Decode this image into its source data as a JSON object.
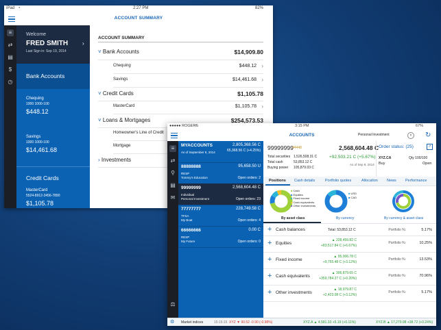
{
  "back": {
    "status": {
      "carrier": "iPad",
      "wifi": "◔",
      "time": "2:27 PM",
      "battery": "82%"
    },
    "nav_title": "ACCOUNT SUMMARY",
    "welcome": {
      "greeting": "Welcome",
      "name": "FRED SMITH",
      "last_signin": "Last Sign in: Sep 19, 2014"
    },
    "menu": {
      "bank_accounts": "Bank Accounts",
      "chequing_label": "Chequing",
      "chequing_num": "1000 1000-100",
      "chequing_bal": "$448.12",
      "savings_label": "Savings",
      "savings_num": "1000 1000-100",
      "savings_bal": "$14,461.68",
      "credit_cards": "Credit Cards",
      "mastercard_label": "MasterCard",
      "mastercard_num": "5524-8912-3456-7890",
      "mastercard_bal": "$1,105.78"
    },
    "summary": {
      "heading": "ACCOUNT SUMMARY",
      "bank_label": "Bank Accounts",
      "bank_total": "$14,909.80",
      "chequing": "Chequing",
      "chequing_amt": "$448.12",
      "savings": "Savings",
      "savings_amt": "$14,461.68",
      "cc_label": "Credit Cards",
      "cc_total": "$1,105.78",
      "mastercard": "MasterCard",
      "mastercard_amt": "$1,105.78",
      "loans_label": "Loans & Mortgages",
      "loans_total": "$254,573.53",
      "heloc": "Homeowner's Line of Credit",
      "mortgage": "Mortgage",
      "investments": "Investments"
    }
  },
  "front": {
    "status": {
      "carrier": "●●●●● ROGERS",
      "wifi": "◔",
      "time": "3:15 PM",
      "battery": "67%"
    },
    "nav_title": "ACCOUNTS",
    "investment_select": "Personal Investment",
    "accounts": [
      {
        "name": "MYACCOUNTS",
        "value": "2,805,368.56 C",
        "sub1": "As of September 9, 2014",
        "sub2": "",
        "extra": "65,368.56 C (+4.25%)"
      },
      {
        "name": "88888888",
        "value": "95,658.50 U",
        "sub1": "RESP",
        "sub2": "Tommy's Education",
        "extra": "Open orders: 2"
      },
      {
        "name": "99999999",
        "value": "2,568,604.48 C",
        "sub1": "Individual",
        "sub2": "Personal Investment",
        "extra": "Open orders: 23"
      },
      {
        "name": "77777777",
        "value": "228,749.58 C",
        "sub1": "TFSA",
        "sub2": "My Boat",
        "extra": "Open orders: 4"
      },
      {
        "name": "66666666",
        "value": "0.00 C",
        "sub1": "RESP",
        "sub2": "My Future",
        "extra": "Open orders: 0"
      }
    ],
    "detail": {
      "acct_num": "99999999",
      "acct_code": "#4448",
      "acct_value": "2,568,604.48 C",
      "total_securities_label": "Total securities",
      "total_securities": "1,526,508.31 C",
      "total_cash_label": "Total cash",
      "total_cash": "53,853.12 C",
      "buying_power_label": "Buying power",
      "buying_power": "105,879.03 C",
      "change": "+92,503.21 C (+5.67%)",
      "as_of": "As of Sep 9, 2014",
      "order_status": "Order status: (25)",
      "order_symbol": "XYZ.CA",
      "order_side": "Buy",
      "order_qty": "Qty 100/100",
      "order_state": "Open"
    },
    "tabs": [
      "Positions",
      "Cash details",
      "Portfolio quotes",
      "Allocation",
      "News",
      "Performance"
    ],
    "charts": {
      "asset_legend": [
        "Cash",
        "Equities",
        "Fixed income",
        "Cash equivalents",
        "Other investments"
      ],
      "currency_legend": [
        "USD",
        "CAD"
      ],
      "by_asset": "By asset class",
      "by_currency": "By currency",
      "by_both": "By currency & asset class"
    },
    "cash_row": {
      "label": "Cash balances",
      "total": "Total: 53,853.12 C",
      "pct_label": "Portfolio %:",
      "pct": "5.17%"
    },
    "holdings": [
      {
        "name": "Equities",
        "mv": "▲ 228,459.82 C",
        "chg": "+83,517.84 C (+6.67%)",
        "pct_label": "Portfolio %:",
        "pct": "10.25%"
      },
      {
        "name": "Fixed income",
        "mv": "▲ 95,006.78 C",
        "chg": "+9,755.48 C (+3.12%)",
        "pct_label": "Portfolio %:",
        "pct": "13.53%"
      },
      {
        "name": "Cash equivalents",
        "mv": "▲ 306,879.65 C",
        "chg": "+359,784.27 C (+0.20%)",
        "pct_label": "Portfolio %:",
        "pct": "70.96%"
      },
      {
        "name": "Other investments",
        "mv": "▲ 18,979.87 C",
        "chg": "+2,423.08 C (+3.12%)",
        "pct_label": "Portfolio %:",
        "pct": "5.17%"
      }
    ],
    "ticker": {
      "label": "Market indices",
      "time": "15:15:15",
      "xyz1": "XYZ ▼ 90.52 -0.90 (-0.98%)",
      "xyz2": "XYZ.A ▲ 4,581.33 +5.19 (+0.11%)",
      "xyz3": "XYZ.B ▲ 17,279.98 +38.72 (+0.24%)"
    }
  }
}
